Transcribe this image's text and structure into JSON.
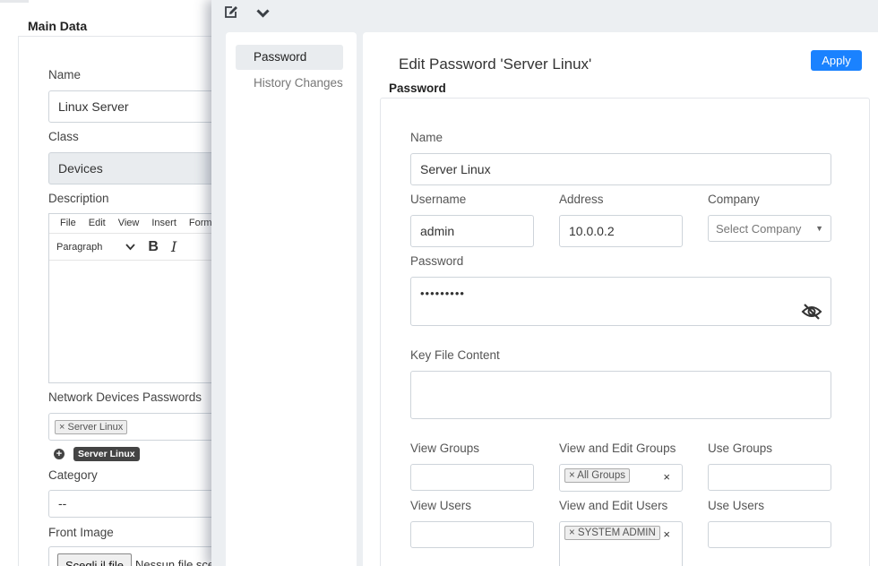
{
  "background": {
    "section_title": "Main Data",
    "name_label": "Name",
    "name_value": "Linux Server",
    "class_label": "Class",
    "class_value": "Devices",
    "description_label": "Description",
    "editor_menu": [
      "File",
      "Edit",
      "View",
      "Insert",
      "Forma"
    ],
    "editor_block_format": "Paragraph",
    "editor_bold": "B",
    "editor_italic": "I",
    "network_devices_label": "Network Devices Passwords",
    "network_device_tag": "× Server Linux",
    "network_device_badge": "Server Linux",
    "category_label": "Category",
    "category_value": "--",
    "front_image_label": "Front Image",
    "file_button": "Scegli il file",
    "file_status": "Nessun file sce"
  },
  "overlay": {
    "nav": [
      {
        "label": "Password",
        "active": true
      },
      {
        "label": "History Changes",
        "active": false
      }
    ],
    "title": "Edit Password 'Server Linux'",
    "apply_label": "Apply",
    "section_title": "Password",
    "form": {
      "name_label": "Name",
      "name_value": "Server Linux",
      "username_label": "Username",
      "username_value": "admin",
      "address_label": "Address",
      "address_value": "10.0.0.2",
      "company_label": "Company",
      "company_placeholder": "Select Company",
      "password_label": "Password",
      "password_value": "•••••••••",
      "key_file_label": "Key File Content",
      "key_file_value": "",
      "view_groups_label": "View Groups",
      "view_edit_groups_label": "View and Edit Groups",
      "view_edit_groups_tag": "× All Groups",
      "use_groups_label": "Use Groups",
      "view_users_label": "View Users",
      "view_edit_users_label": "View and Edit Users",
      "view_edit_users_tag": "× SYSTEM ADMIN",
      "use_users_label": "Use Users",
      "clear_symbol": "×"
    }
  },
  "colors": {
    "accent": "#1a82ff",
    "panel_bg": "#eceff2",
    "nav_active_bg": "#e9ecef"
  },
  "icons": {
    "edit": "edit-icon",
    "chevron": "chevron-down-icon",
    "eye_slash": "eye-slash-icon",
    "plus": "plus-circle-icon"
  }
}
